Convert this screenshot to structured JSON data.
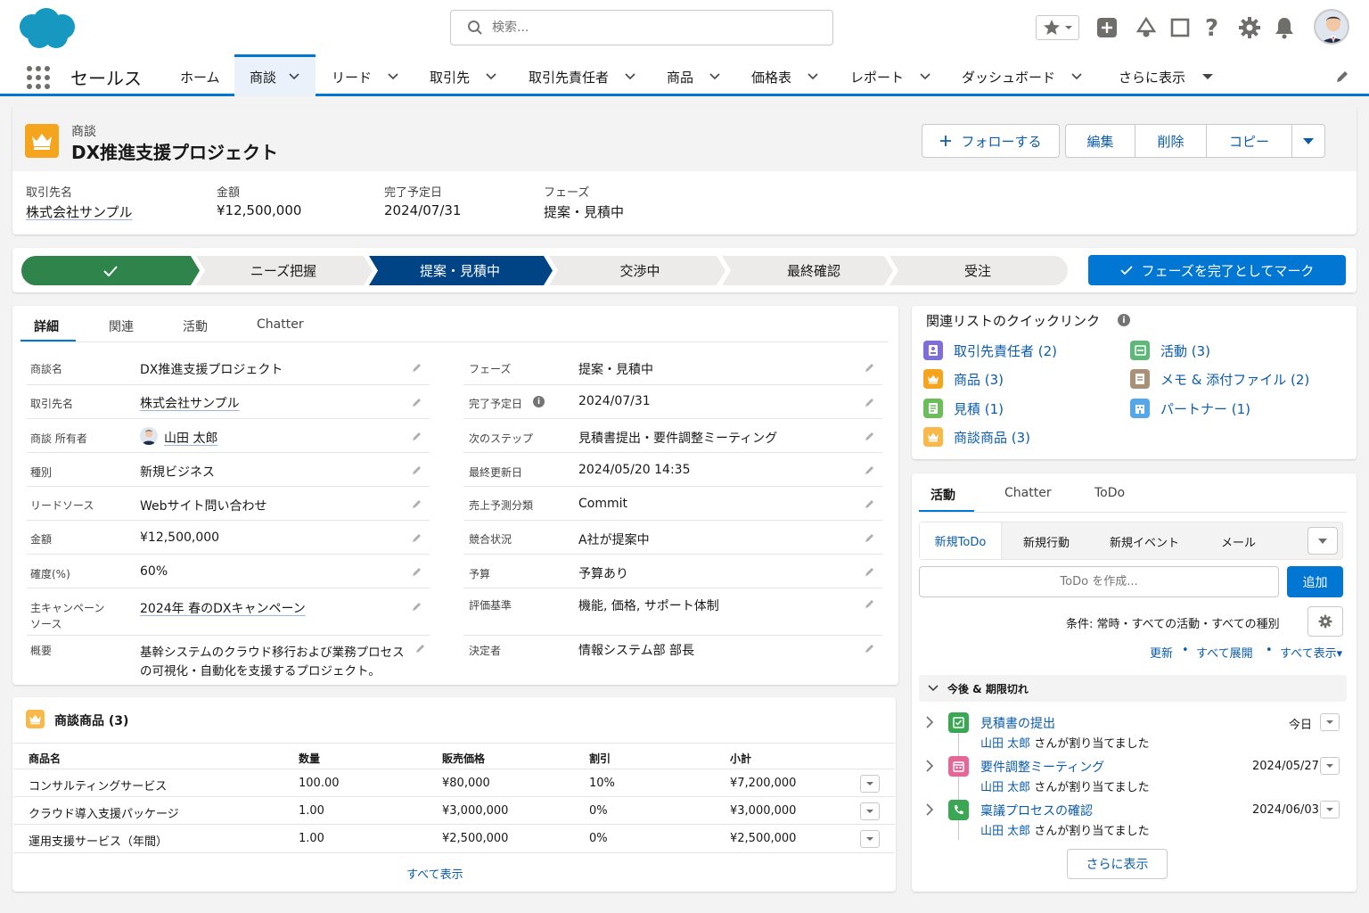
{
  "search": {
    "placeholder": "検索..."
  },
  "app": {
    "name": "セールス"
  },
  "nav": [
    {
      "label": "ホーム"
    },
    {
      "label": "商談"
    },
    {
      "label": "リード"
    },
    {
      "label": "取引先"
    },
    {
      "label": "取引先責任者"
    },
    {
      "label": "商品"
    },
    {
      "label": "価格表"
    },
    {
      "label": "レポート"
    },
    {
      "label": "ダッシュボード"
    },
    {
      "label": "さらに表示"
    }
  ],
  "record": {
    "object": "商談",
    "name": "DX推進支援プロジェクト",
    "buttons": {
      "follow": "フォローする",
      "edit": "編集",
      "delete": "削除",
      "copy": "コピー"
    },
    "highlights": [
      {
        "label": "取引先名",
        "value": "株式会社サンプル"
      },
      {
        "label": "金額",
        "value": "¥12,500,000"
      },
      {
        "label": "完了予定日",
        "value": "2024/07/31"
      },
      {
        "label": "フェーズ",
        "value": "提案・見積中"
      }
    ]
  },
  "path": {
    "steps": [
      "",
      "ニーズ把握",
      "提案・見積中",
      "交渉中",
      "最終確認",
      "受注"
    ],
    "complete_button": "フェーズを完了としてマーク"
  },
  "details": {
    "tabs": [
      "詳細",
      "関連",
      "活動",
      "Chatter"
    ],
    "left": [
      {
        "label": "商談名",
        "value": "DX推進支援プロジェクト"
      },
      {
        "label": "取引先名",
        "value": "株式会社サンプル"
      },
      {
        "label": "商談 所有者",
        "value": "山田 太郎"
      },
      {
        "label": "種別",
        "value": "新規ビジネス"
      },
      {
        "label": "リードソース",
        "value": "Webサイト問い合わせ"
      },
      {
        "label": "金額",
        "value": "¥12,500,000"
      },
      {
        "label": "確度(%)",
        "value": "60%"
      },
      {
        "label": "主キャンペーン",
        "label2": "ソース",
        "value": "2024年 春のDXキャンペーン"
      },
      {
        "label": "概要",
        "value": "基幹システムのクラウド移行および業務プロセス",
        "value2": "の可視化・自動化を支援するプロジェクト。"
      }
    ],
    "right": [
      {
        "label": "フェーズ",
        "value": "提案・見積中"
      },
      {
        "label": "完了予定日",
        "value": "2024/07/31"
      },
      {
        "label": "次のステップ",
        "value": "見積書提出・要件調整ミーティング"
      },
      {
        "label": "最終更新日",
        "value": "2024/05/20 14:35"
      },
      {
        "label": "売上予測分類",
        "value": "Commit"
      },
      {
        "label": "競合状況",
        "value": "A社が提案中"
      },
      {
        "label": "予算",
        "value": "予算あり"
      },
      {
        "label": "評価基準",
        "value": "機能, 価格, サポート体制"
      },
      {
        "label": "決定者",
        "value": "情報システム部 部長"
      }
    ]
  },
  "products": {
    "title": "商談商品 (3)",
    "columns": [
      "商品名",
      "数量",
      "販売価格",
      "割引",
      "小計"
    ],
    "rows": [
      [
        "コンサルティングサービス",
        "100.00",
        "¥80,000",
        "10%",
        "¥7,200,000"
      ],
      [
        "クラウド導入支援パッケージ",
        "1.00",
        "¥3,000,000",
        "0%",
        "¥3,000,000"
      ],
      [
        "運用支援サービス（年間）",
        "1.00",
        "¥2,500,000",
        "0%",
        "¥2,500,000"
      ]
    ],
    "view_all": "すべて表示"
  },
  "quicklinks": {
    "title": "関連リストのクイックリンク",
    "items": [
      {
        "label": "取引先責任者 (2)",
        "color": "#7f6ed8"
      },
      {
        "label": "活動 (3)",
        "color": "#5fb87a"
      },
      {
        "label": "商品 (3)",
        "color": "#f4a41d"
      },
      {
        "label": "メモ & 添付ファイル (2)",
        "color": "#a89277"
      },
      {
        "label": "見積 (1)",
        "color": "#6bbd5b"
      },
      {
        "label": "パートナー (1)",
        "color": "#54a7e8"
      },
      {
        "label": "商談商品 (3)",
        "color": "#f8b84a"
      }
    ]
  },
  "activity": {
    "tabs": [
      "活動",
      "Chatter",
      "ToDo"
    ],
    "subtabs": [
      "新規ToDo",
      "新規行動",
      "新規イベント",
      "メール"
    ],
    "todo_placeholder": "ToDo を作成...",
    "add_button": "追加",
    "filter": "条件: 常時・すべての活動・すべての種別",
    "links": [
      "更新",
      "すべて展開",
      "すべて表示▾"
    ],
    "section": "今後 & 期限切れ",
    "items": [
      {
        "title": "見積書の提出",
        "user": "山田 太郎",
        "suffix": "さんが割り当てました",
        "date": "今日",
        "color": "#3ba755"
      },
      {
        "title": "要件調整ミーティング",
        "user": "山田 太郎",
        "suffix": "さんが割り当てました",
        "date": "2024/05/27",
        "color": "#e56798"
      },
      {
        "title": "稟議プロセスの確認",
        "user": "山田 太郎",
        "suffix": "さんが割り当てました",
        "date": "2024/06/03",
        "color": "#3ba755"
      }
    ],
    "more_button": "さらに表示"
  },
  "colors": {
    "brand": "#0176d3",
    "path_done": "#2e844a",
    "path_current": "#014486",
    "link": "#0b5cab"
  }
}
